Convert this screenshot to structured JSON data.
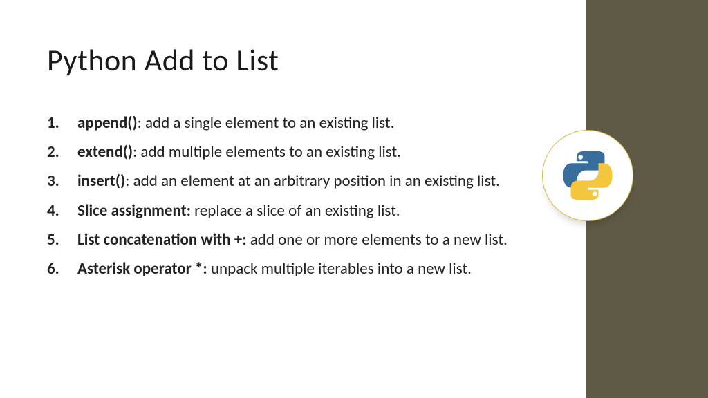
{
  "title": "Python Add to List",
  "items": [
    {
      "term": "append()",
      "desc": ": add a single element to an existing list."
    },
    {
      "term": "extend()",
      "desc": ": add multiple elements to an existing list."
    },
    {
      "term": "insert()",
      "desc": ": add an element at an arbitrary position in an existing list."
    },
    {
      "term": "Slice assignment:",
      "desc": " replace a slice of an existing list."
    },
    {
      "term": "List concatenation with +:",
      "desc": " add one or more elements to a new list."
    },
    {
      "term": "Asterisk operator *:",
      "desc": " unpack multiple iterables into a new list."
    }
  ],
  "logo": {
    "name": "python-logo-icon",
    "colors": {
      "blue": "#386e9c",
      "yellow": "#f4c63d"
    }
  }
}
